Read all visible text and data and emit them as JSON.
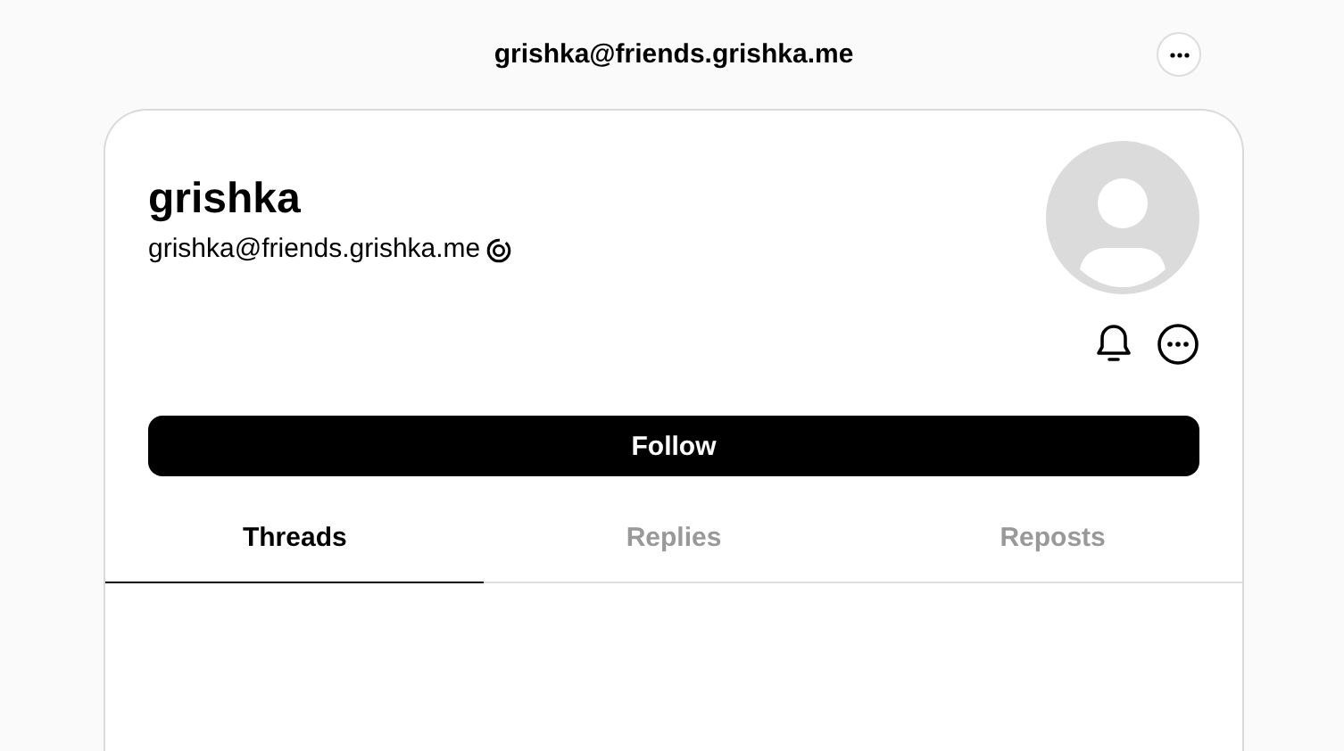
{
  "header": {
    "title": "grishka@friends.grishka.me"
  },
  "profile": {
    "name": "grishka",
    "handle": "grishka@friends.grishka.me"
  },
  "follow_button": {
    "label": "Follow"
  },
  "tabs": [
    {
      "label": "Threads",
      "selected": true
    },
    {
      "label": "Replies",
      "selected": false
    },
    {
      "label": "Reposts",
      "selected": false
    }
  ]
}
